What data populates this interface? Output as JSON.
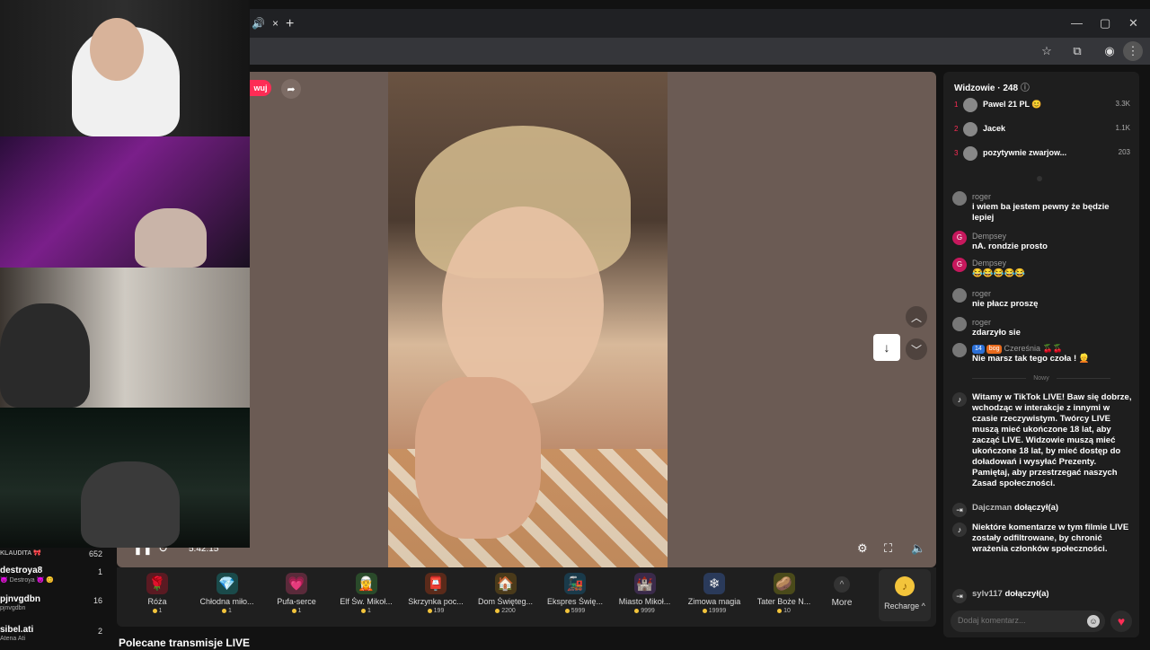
{
  "browser": {
    "tab_close": "×",
    "tab_audio": "🔊",
    "new_tab": "+",
    "window_min": "—",
    "window_restore": "▢",
    "window_close": "✕"
  },
  "player": {
    "follow_label": "wuj",
    "timecode": "5:42:15",
    "gifts": [
      {
        "name": "Róża",
        "price": "1",
        "icon": "🌹",
        "color": "#5a1a22"
      },
      {
        "name": "Chłodna miło...",
        "price": "1",
        "icon": "💎",
        "color": "#1a4a4a"
      },
      {
        "name": "Pufa-serce",
        "price": "1",
        "icon": "💗",
        "color": "#5a2a3a"
      },
      {
        "name": "Elf Św. Mikoł...",
        "price": "1",
        "icon": "🧝",
        "color": "#2a4a2a"
      },
      {
        "name": "Skrzynka poc...",
        "price": "199",
        "icon": "📮",
        "color": "#5a2a1a"
      },
      {
        "name": "Dom Święteg...",
        "price": "2200",
        "icon": "🏠",
        "color": "#4a3a1a"
      },
      {
        "name": "Ekspres Świę...",
        "price": "5999",
        "icon": "🚂",
        "color": "#1a3a4a"
      },
      {
        "name": "Miasto Mikoł...",
        "price": "9999",
        "icon": "🏰",
        "color": "#3a2a4a"
      },
      {
        "name": "Zimowa magia",
        "price": "19999",
        "icon": "❄",
        "color": "#2a3a5a"
      },
      {
        "name": "Tater Boże N...",
        "price": "10",
        "icon": "🥔",
        "color": "#4a4a1a"
      }
    ],
    "more_label": "More",
    "recharge_label": "Recharge ^"
  },
  "recommended": "Polecane transmisje LIVE",
  "panel": {
    "viewers_title": "Widzowie · 248",
    "top_viewers": [
      {
        "rank": "1",
        "name": "Pawel 21 PL 😊",
        "count": "3.3K"
      },
      {
        "rank": "2",
        "name": "Jacek",
        "count": "1.1K"
      },
      {
        "rank": "3",
        "name": "pozytywnie zwarjow...",
        "count": "203"
      }
    ],
    "new_label": "Nowy",
    "comment_placeholder": "Dodaj komentarz..."
  },
  "chat": [
    {
      "user": "roger",
      "text": "i wiem ba jestem pewny że będzie lepiej",
      "avatar": "img"
    },
    {
      "user": "Dempsey",
      "text": "nA. rondzie prosto",
      "avatar": "G"
    },
    {
      "user": "Dempsey",
      "text": "😂😂😂😂😂",
      "avatar": "G"
    },
    {
      "user": "roger",
      "text": "nie płacz proszę",
      "avatar": "img"
    },
    {
      "user": "roger",
      "text": "zdarzyło sie",
      "avatar": "img"
    },
    {
      "user": "Czereśnia 🍒🍒",
      "badges": [
        "14",
        "bog"
      ],
      "text": "Nie marsz tak tego czoła ! 👱",
      "avatar": "img"
    }
  ],
  "system_messages": [
    {
      "text": "Witamy w TikTok LIVE! Baw się dobrze, wchodząc w interakcje z innymi w czasie rzeczywistym. Twórcy LIVE muszą mieć ukończone 18 lat, aby zacząć LIVE. Widzowie muszą mieć ukończone 18 lat, by mieć dostęp do doładowań i wysyłać Prezenty. Pamiętaj, aby przestrzegać naszych Zasad społeczności."
    },
    {
      "user": "Dajczman",
      "text": "dołączył(a)"
    },
    {
      "text": "Niektóre komentarze w tym filmie LIVE zostały odfiltrowane, by chronić wrażenia członków społeczności."
    },
    {
      "user": "sylv117",
      "text": "dołączył(a)"
    }
  ],
  "side_list": [
    {
      "name": "KLAUDITA 🎀",
      "count": "652",
      "sub": ""
    },
    {
      "name": "destroya8",
      "count": "1",
      "sub": "😈 Destroya 😈 😊"
    },
    {
      "name": "pjnvgdbn",
      "count": "16",
      "sub": "pjnvgdbn"
    },
    {
      "name": "sibel.ati",
      "count": "2",
      "sub": "Atena Ati"
    }
  ]
}
